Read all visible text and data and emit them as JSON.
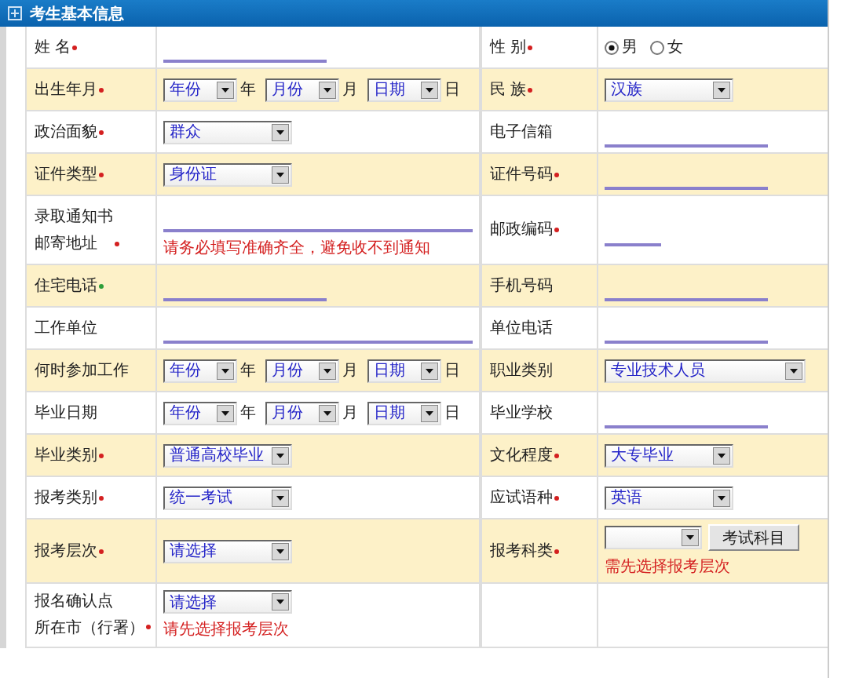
{
  "panel": {
    "title": "考生基本信息"
  },
  "rows": [
    {
      "cells": [
        {
          "label": "姓 名",
          "color": "#d42020",
          "field": {
            "kind": "line"
          }
        },
        {
          "label": "性 别",
          "color": "#d42020",
          "field": {
            "kind": "radio",
            "options": [
              {
                "label": "男",
                "selected": true
              },
              {
                "label": "女",
                "selected": false
              }
            ]
          }
        }
      ]
    },
    {
      "cells": [
        {
          "label": "出生年月",
          "color": "#d42020",
          "field": {
            "kind": "date",
            "parts": [
              {
                "value": "年份",
                "unit": "年"
              },
              {
                "value": "月份",
                "unit": "月"
              },
              {
                "value": "日期",
                "unit": "日"
              }
            ]
          }
        },
        {
          "label": "民 族",
          "color": "#d42020",
          "field": {
            "kind": "select",
            "value": "汉族"
          }
        }
      ]
    },
    {
      "cells": [
        {
          "label": "政治面貌",
          "color": "#d42020",
          "field": {
            "kind": "select",
            "value": "群众"
          }
        },
        {
          "label": "电子信箱",
          "field": {
            "kind": "line"
          }
        }
      ]
    },
    {
      "cells": [
        {
          "label": "证件类型",
          "color": "#d42020",
          "field": {
            "kind": "select",
            "value": "身份证"
          }
        },
        {
          "label": "证件号码",
          "color": "#d42020",
          "field": {
            "kind": "line"
          }
        }
      ]
    },
    {
      "cells": [
        {
          "lines": [
            "录取通知书",
            "邮寄地址"
          ],
          "color": "#d42020",
          "field": {
            "kind": "longline",
            "note": "请务必填写准确齐全，避免收不到通知"
          }
        },
        {
          "label": "邮政编码",
          "color": "#d42020",
          "field": {
            "kind": "shortline"
          }
        }
      ]
    },
    {
      "cells": [
        {
          "label": "住宅电话",
          "color": "#2e9e3a",
          "field": {
            "kind": "line"
          }
        },
        {
          "label": "手机号码",
          "field": {
            "kind": "line"
          }
        }
      ]
    },
    {
      "cells": [
        {
          "label": "工作单位",
          "field": {
            "kind": "longline"
          }
        },
        {
          "label": "单位电话",
          "field": {
            "kind": "line"
          }
        }
      ]
    },
    {
      "cells": [
        {
          "label": "何时参加工作",
          "field": {
            "kind": "date",
            "parts": [
              {
                "value": "年份",
                "unit": "年"
              },
              {
                "value": "月份",
                "unit": "月"
              },
              {
                "value": "日期",
                "unit": "日"
              }
            ]
          }
        },
        {
          "label": "职业类别",
          "field": {
            "kind": "wideselect",
            "value": "专业技术人员"
          }
        }
      ]
    },
    {
      "cells": [
        {
          "label": "毕业日期",
          "field": {
            "kind": "date",
            "parts": [
              {
                "value": "年份",
                "unit": "年"
              },
              {
                "value": "月份",
                "unit": "月"
              },
              {
                "value": "日期",
                "unit": "日"
              }
            ]
          }
        },
        {
          "label": "毕业学校",
          "field": {
            "kind": "line"
          }
        }
      ]
    },
    {
      "cells": [
        {
          "label": "毕业类别",
          "color": "#d42020",
          "field": {
            "kind": "select",
            "value": "普通高校毕业"
          }
        },
        {
          "label": "文化程度",
          "color": "#d42020",
          "field": {
            "kind": "select",
            "value": "大专毕业"
          }
        }
      ]
    },
    {
      "cells": [
        {
          "label": "报考类别",
          "color": "#d42020",
          "field": {
            "kind": "select",
            "value": "统一考试"
          }
        },
        {
          "label": "应试语种",
          "color": "#d42020",
          "field": {
            "kind": "select",
            "value": "英语"
          }
        }
      ]
    },
    {
      "cells": [
        {
          "label": "报考层次",
          "color": "#d42020",
          "field": {
            "kind": "select",
            "value": "请选择"
          }
        },
        {
          "label": "报考科类",
          "color": "#d42020",
          "field": {
            "kind": "select",
            "button": "考试科目",
            "note": "需先选择报考层次"
          }
        }
      ]
    },
    {
      "cells": [
        {
          "lines": [
            "报名确认点",
            "所在市（行署）"
          ],
          "color": "#d42020",
          "field": {
            "kind": "select",
            "value": "请选择",
            "note": "请先选择报考层次"
          }
        }
      ]
    }
  ]
}
